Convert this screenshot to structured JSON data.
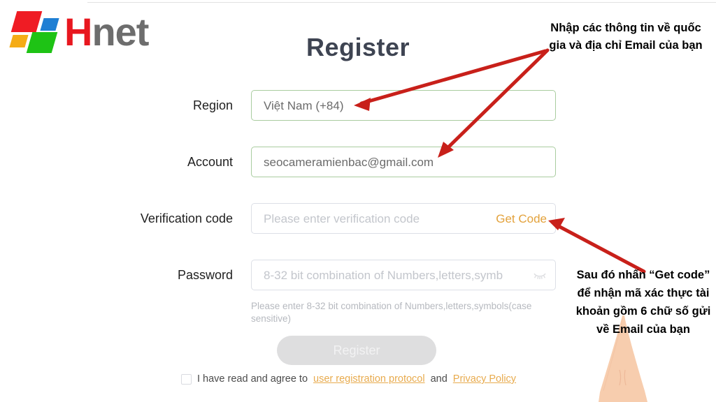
{
  "brand": {
    "name_first": "H",
    "name_rest": "net",
    "logo_icon": "hnet-tiles-logo",
    "colors": {
      "red": "#ef1c24",
      "blue": "#1f7fd4",
      "orange": "#f5ac16",
      "green": "#1ec315",
      "text_red": "#e8171f",
      "text_gray": "#6d6d6d"
    }
  },
  "form": {
    "title": "Register",
    "fields": [
      {
        "label": "Region",
        "value": "Việt Nam (+84)",
        "placeholder": "",
        "is_placeholder": false,
        "valid": true
      },
      {
        "label": "Account",
        "value": "seocameramienbac@gmail.com",
        "placeholder": "",
        "is_placeholder": false,
        "valid": true
      },
      {
        "label": "Verification code",
        "value": "",
        "placeholder": "Please enter verification code",
        "is_placeholder": true,
        "valid": false
      },
      {
        "label": "Password",
        "value": "",
        "placeholder": "8-32 bit combination of Numbers,letters,symb",
        "is_placeholder": true,
        "valid": false
      }
    ],
    "get_code_label": "Get Code",
    "get_code_color": "#e3a23c",
    "password_toggle_icon": "eye-closed-icon",
    "helper_text": "Please enter 8-32 bit combination of Numbers,letters,symbols(case sensitive)",
    "submit_label": "Register",
    "agreement": {
      "checked": false,
      "prefix": "I have read and agree to",
      "link1": "user registration protocol",
      "conjunction": "and",
      "link2": "Privacy Policy",
      "link_color": "#e8ab4e"
    }
  },
  "annotations": {
    "arrow_color": "#c8201a",
    "top_note": "Nhập các thông tin về quốc gia và địa chỉ Email của bạn",
    "bottom_note": "Sau đó nhấn “Get code” để nhận mã xác thực tài khoản gồm 6 chữ số gửi về Email của bạn"
  }
}
